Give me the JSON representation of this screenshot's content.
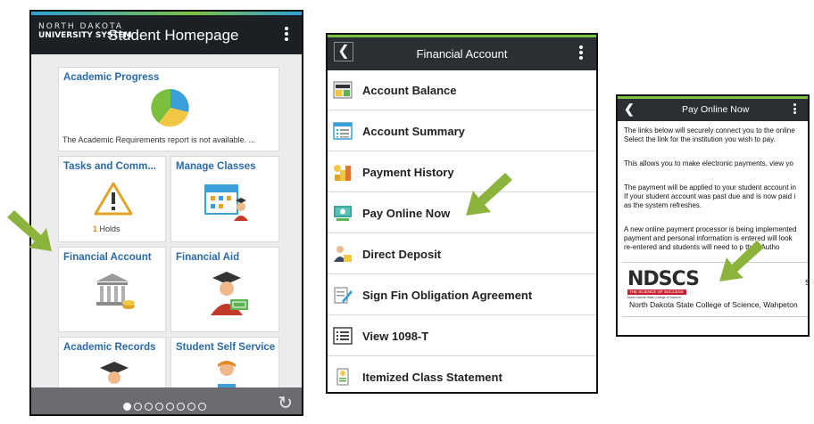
{
  "colors": {
    "arrow": "#8cb43c",
    "tile_title": "#2a6aa8",
    "header_dark": "#1c1f24",
    "accent_line": "#7cc242",
    "logo_red": "#c8202f"
  },
  "screen1": {
    "logo_line1": "NORTH DAKOTA",
    "logo_line2": "UNIVERSITY SYSTEM",
    "title": "Student Homepage",
    "tiles": [
      {
        "title": "Academic Progress",
        "note": "The Academic Requirements report is not available.  ...",
        "icon": "pie-chart-icon"
      },
      {
        "title": "Tasks and Comm...",
        "holds_count": "1",
        "holds_label": "Holds",
        "icon": "warning-icon"
      },
      {
        "title": "Manage Classes",
        "icon": "calendar-student-icon"
      },
      {
        "title": "Financial Account",
        "icon": "bank-coins-icon"
      },
      {
        "title": "Financial Aid",
        "icon": "graduate-money-icon"
      },
      {
        "title": "Academic Records",
        "icon": "graduate-icon"
      },
      {
        "title": "Student Self Service",
        "icon": "reader-icon"
      }
    ],
    "pager": {
      "total": 8,
      "active": 1
    },
    "refresh_icon": "refresh-icon"
  },
  "screen2": {
    "title": "Financial Account",
    "back_icon": "chevron-left-icon",
    "items": [
      {
        "label": "Account Balance",
        "icon": "account-balance-icon"
      },
      {
        "label": "Account Summary",
        "icon": "account-summary-icon"
      },
      {
        "label": "Payment History",
        "icon": "payment-history-icon"
      },
      {
        "label": "Pay Online Now",
        "icon": "pay-online-icon"
      },
      {
        "label": "Direct Deposit",
        "icon": "direct-deposit-icon"
      },
      {
        "label": "Sign Fin Obligation Agreement",
        "icon": "sign-agreement-icon"
      },
      {
        "label": "View 1098-T",
        "icon": "view-1098t-icon"
      },
      {
        "label": "Itemized Class Statement",
        "icon": "itemized-statement-icon"
      }
    ]
  },
  "screen3": {
    "title": "Pay Online Now",
    "lines": [
      "The links below will securely connect you to the online",
      "Select the link for the institution you wish to pay.",
      "This allows you to make electronic payments, view yo",
      "The payment will be applied to your student account in",
      "If your student account was past due and is now paid i",
      "as the system refreshes.",
      "A new online payment processor is being implemented",
      "payment and personal information is entered will look",
      "re-entered and students will need to        p their Autho"
    ],
    "logo_word": "NDSCS",
    "logo_tagline": "THE SCIENCE OF SUCCESS",
    "logo_subline": "North Dakota State College of Science",
    "institution": "North Dakota State College of Science, Wahpeton",
    "trailing_char": "S"
  }
}
